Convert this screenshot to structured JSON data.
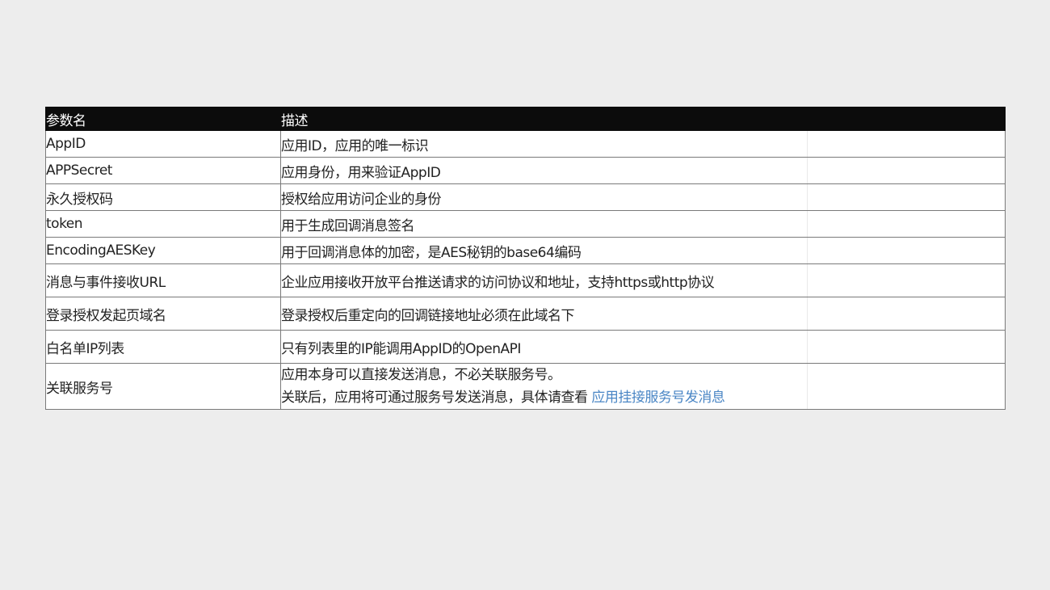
{
  "table": {
    "headers": {
      "name": "参数名",
      "desc": "描述"
    },
    "rows": [
      {
        "name": "AppID",
        "desc": "应用ID，应用的唯一标识"
      },
      {
        "name": "APPSecret",
        "desc": "应用身份，用来验证AppID"
      },
      {
        "name": "永久授权码",
        "desc": "授权给应用访问企业的身份"
      },
      {
        "name": "token",
        "desc": "用于生成回调消息签名"
      },
      {
        "name": "EncodingAESKey",
        "desc": "用于回调消息体的加密，是AES秘钥的base64编码"
      },
      {
        "name": "消息与事件接收URL",
        "desc": "企业应用接收开放平台推送请求的访问协议和地址，支持https或http协议"
      },
      {
        "name": "登录授权发起页域名",
        "desc": "登录授权后重定向的回调链接地址必须在此域名下"
      },
      {
        "name": "白名单IP列表",
        "desc": "只有列表里的IP能调用AppID的OpenAPI"
      },
      {
        "name": "关联服务号",
        "desc_line1": "应用本身可以直接发送消息，不必关联服务号。",
        "desc_line2_prefix": "关联后，应用将可通过服务号发送消息，具体请查看 ",
        "desc_link": "应用挂接服务号发消息"
      }
    ]
  },
  "colors": {
    "header_bg": "#0c0c0c",
    "page_bg": "#ededed",
    "link": "#4a86c5"
  }
}
